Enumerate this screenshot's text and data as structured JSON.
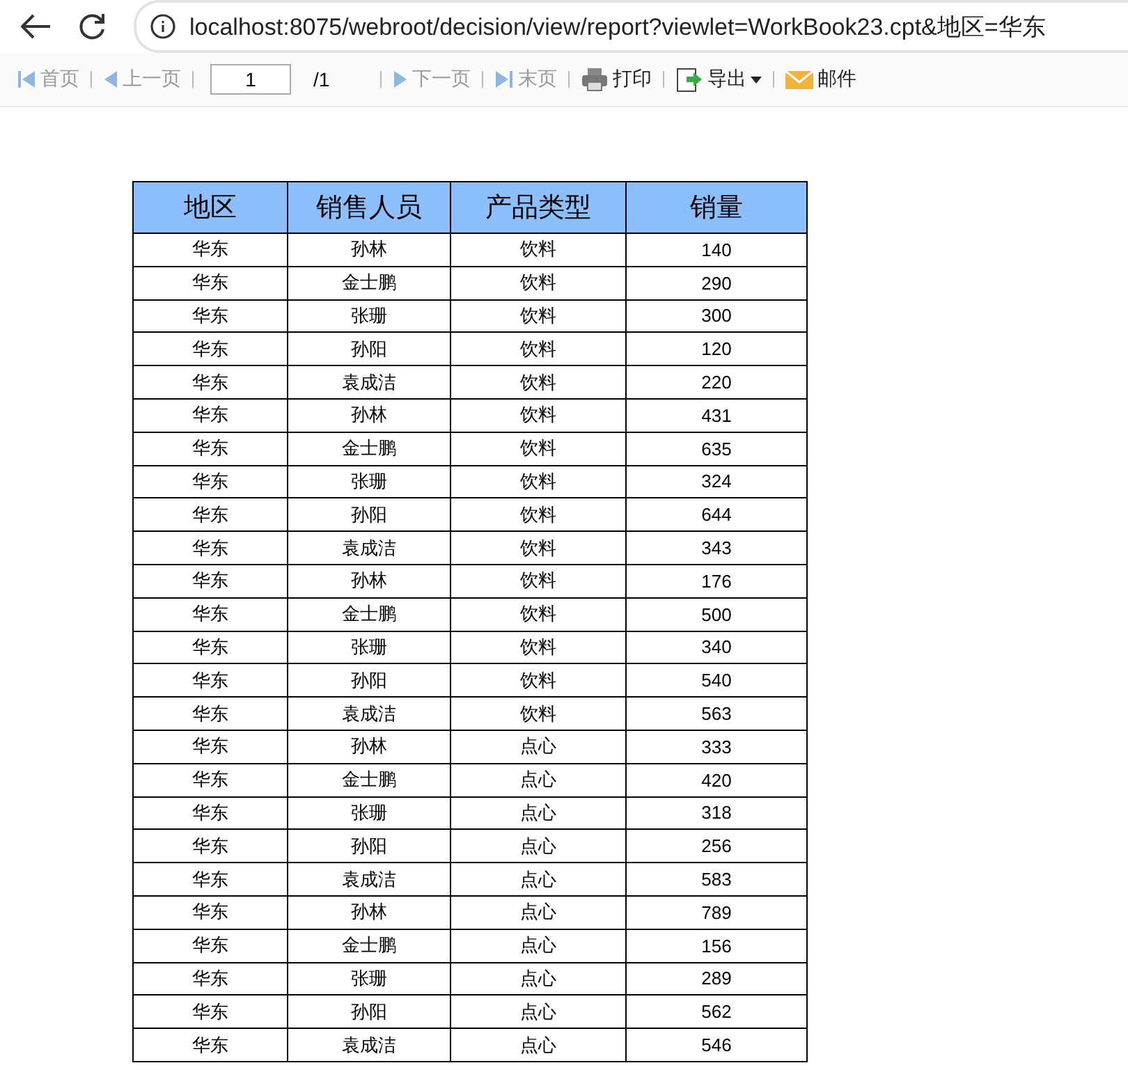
{
  "browser": {
    "url": "localhost:8075/webroot/decision/view/report?viewlet=WorkBook23.cpt&地区=华东"
  },
  "toolbar": {
    "nav": [
      {
        "kind": "first",
        "label": "首页",
        "disabled": true
      },
      {
        "kind": "prev",
        "label": "上一页",
        "disabled": true
      }
    ],
    "page_input": "1",
    "page_total": "/1",
    "nav2": [
      {
        "kind": "next",
        "label": "下一页",
        "disabled": true
      },
      {
        "kind": "last",
        "label": "末页",
        "disabled": true
      }
    ],
    "actions": [
      {
        "kind": "print",
        "label": "打印"
      },
      {
        "kind": "export",
        "label": "导出"
      },
      {
        "kind": "mail",
        "label": "邮件"
      }
    ]
  },
  "table": {
    "columns": [
      "地区",
      "销售人员",
      "产品类型",
      "销量"
    ],
    "rows": [
      [
        "华东",
        "孙林",
        "饮料",
        "140"
      ],
      [
        "华东",
        "金士鹏",
        "饮料",
        "290"
      ],
      [
        "华东",
        "张珊",
        "饮料",
        "300"
      ],
      [
        "华东",
        "孙阳",
        "饮料",
        "120"
      ],
      [
        "华东",
        "袁成洁",
        "饮料",
        "220"
      ],
      [
        "华东",
        "孙林",
        "饮料",
        "431"
      ],
      [
        "华东",
        "金士鹏",
        "饮料",
        "635"
      ],
      [
        "华东",
        "张珊",
        "饮料",
        "324"
      ],
      [
        "华东",
        "孙阳",
        "饮料",
        "644"
      ],
      [
        "华东",
        "袁成洁",
        "饮料",
        "343"
      ],
      [
        "华东",
        "孙林",
        "饮料",
        "176"
      ],
      [
        "华东",
        "金士鹏",
        "饮料",
        "500"
      ],
      [
        "华东",
        "张珊",
        "饮料",
        "340"
      ],
      [
        "华东",
        "孙阳",
        "饮料",
        "540"
      ],
      [
        "华东",
        "袁成洁",
        "饮料",
        "563"
      ],
      [
        "华东",
        "孙林",
        "点心",
        "333"
      ],
      [
        "华东",
        "金士鹏",
        "点心",
        "420"
      ],
      [
        "华东",
        "张珊",
        "点心",
        "318"
      ],
      [
        "华东",
        "孙阳",
        "点心",
        "256"
      ],
      [
        "华东",
        "袁成洁",
        "点心",
        "583"
      ],
      [
        "华东",
        "孙林",
        "点心",
        "789"
      ],
      [
        "华东",
        "金士鹏",
        "点心",
        "156"
      ],
      [
        "华东",
        "张珊",
        "点心",
        "289"
      ],
      [
        "华东",
        "孙阳",
        "点心",
        "562"
      ],
      [
        "华东",
        "袁成洁",
        "点心",
        "546"
      ]
    ]
  }
}
